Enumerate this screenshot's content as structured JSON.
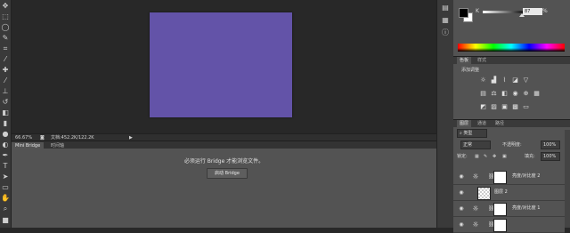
{
  "canvas": {
    "doc_color": "#6353a8"
  },
  "status": {
    "zoom": "66.67%",
    "doc_info": "文档:452.2K/122.2K"
  },
  "bottom_panel": {
    "tabs": [
      "Mini Bridge",
      "时间轴"
    ],
    "message": "必须运行 Bridge 才能浏览文件。",
    "launch_button": "启动 Bridge"
  },
  "color_panel": {
    "channel_label": "K",
    "value": "87",
    "unit": "%",
    "value_fraction": 0.87
  },
  "adjust_panel": {
    "tabs": [
      "色板",
      "样式"
    ],
    "title": "添加调整"
  },
  "layers_panel": {
    "tabs": [
      "图层",
      "通道",
      "路径"
    ],
    "filter": "类型",
    "blend_mode": "正常",
    "opacity_label": "不透明度:",
    "opacity": "100%",
    "lock_label": "锁定:",
    "fill_label": "填充:",
    "fill": "100%",
    "layers": [
      {
        "name": "亮度/对比度 2",
        "type": "adjustment"
      },
      {
        "name": "图层 2",
        "type": "pixel"
      },
      {
        "name": "亮度/对比度 1",
        "type": "adjustment"
      },
      {
        "name": "",
        "type": "adjustment"
      }
    ]
  }
}
